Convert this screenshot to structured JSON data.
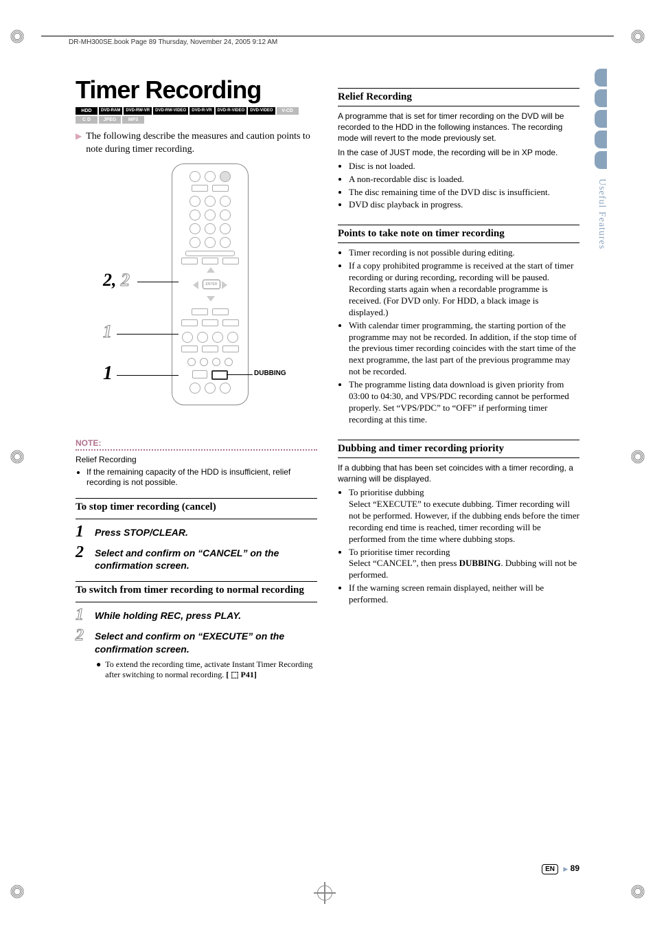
{
  "header": "DR-MH300SE.book  Page 89  Thursday, November 24, 2005  9:12 AM",
  "title": "Timer Recording",
  "formats_active": [
    "HDD",
    "DVD-RAM",
    "DVD-RW-VR",
    "DVD-RW-VIDEO",
    "DVD-R-VR",
    "DVD-R-VIDEO",
    "DVD-VIDEO"
  ],
  "formats_inactive": [
    "V-CD",
    "C D",
    "JPEG",
    "MP3"
  ],
  "intro": "The following describe the measures and caution points to note during timer recording.",
  "remote": {
    "enter_label": "ENTER",
    "dubbing_label": "DUBBING",
    "callouts": {
      "two_solid": "2",
      "two_outline": "2",
      "one_outline": "1",
      "one_solid": "1",
      "comma": ","
    }
  },
  "note": {
    "label": "NOTE:",
    "subhead": "Relief Recording",
    "items": [
      "If the remaining capacity of the HDD is insufficient, relief recording is not possible."
    ]
  },
  "stop_section": {
    "head": "To stop timer recording (cancel)",
    "steps": [
      {
        "num": "1",
        "text_before": "Press ",
        "kw": "STOP/CLEAR",
        "text_after": "."
      },
      {
        "num": "2",
        "text_before": "Select and confirm on “",
        "kw": "CANCEL",
        "text_after": "” on the confirmation screen."
      }
    ]
  },
  "switch_section": {
    "head": "To switch from timer recording to normal recording",
    "steps": [
      {
        "num": "1",
        "text": "While holding REC, press PLAY."
      },
      {
        "num": "2",
        "text_before": "Select and confirm on “",
        "kw": "EXECUTE",
        "text_after": "” on the confirmation screen."
      }
    ],
    "sub": {
      "text": "To extend the recording time, activate Instant Timer Recording after switching to normal recording. ",
      "ref": "[ ⬚ P41]"
    }
  },
  "relief": {
    "head": "Relief Recording",
    "para1": "A programme that is set for timer recording on the DVD will be recorded to the HDD in the following instances. The recording mode will revert to the mode previously set.",
    "para2": "In the case of JUST mode, the recording will be in XP mode.",
    "items": [
      "Disc is not loaded.",
      "A non-recordable disc is loaded.",
      "The disc remaining time of the DVD disc is insufficient.",
      "DVD disc playback in progress."
    ]
  },
  "points": {
    "head": "Points to take note on timer recording",
    "items": [
      "Timer recording is not possible during editing.",
      "If a copy prohibited programme is received at the start of timer recording or during recording, recording will be paused. Recording starts again when a recordable programme is received. (For DVD only. For HDD, a black image is displayed.)",
      "With calendar timer programming, the starting portion of the programme may not be recorded. In addition, if the stop time of the previous timer recording coincides with the start time of the next programme, the last part of the previous programme may not be recorded.",
      "The programme listing data download is given priority from 03:00 to 04:30, and VPS/PDC recording cannot be performed properly. Set “VPS/PDC” to “OFF” if performing timer recording at this time."
    ]
  },
  "dub_priority": {
    "head": "Dubbing and timer recording priority",
    "intro": "If a dubbing that has been set coincides with a timer recording, a warning will be displayed.",
    "items": [
      {
        "lead": "To prioritise dubbing",
        "body": "Select “EXECUTE” to execute dubbing. Timer recording will not be performed. However, if the dubbing ends before the timer recording end time is reached, timer recording will be performed from the time where dubbing stops."
      },
      {
        "lead": "To prioritise timer recording",
        "body_before": "Select “CANCEL”, then press ",
        "bold": "DUBBING",
        "body_after": ". Dubbing will not be performed."
      },
      {
        "lead": "",
        "body": "If the warning screen remain displayed, neither will be performed."
      }
    ]
  },
  "side_tab": "Useful Features",
  "page_footer": {
    "lang": "EN",
    "num": "89"
  }
}
